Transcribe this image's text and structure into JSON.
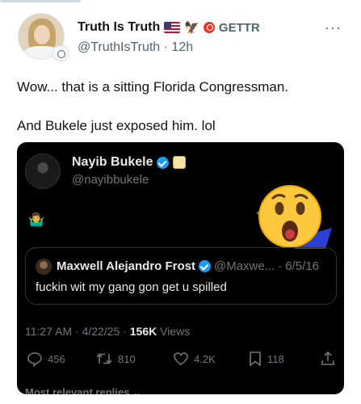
{
  "post": {
    "display_name": "Truth Is Truth",
    "badge_label": "GETTR",
    "handle": "@TruthIsTruth",
    "separator": "·",
    "time": "12h",
    "more_label": "···",
    "text_lines": [
      "Wow... that is a sitting Florida Congressman.",
      "And Bukele just exposed him. lol"
    ]
  },
  "embed": {
    "author_name": "Nayib Bukele",
    "author_handle": "@nayibbukele",
    "body_emoji": "🤷‍♂️",
    "reaction_emoji": "😮",
    "quote": {
      "name": "Maxwell Alejandro Frost",
      "handle": "@Maxwe...",
      "separator": "·",
      "date": "6/5/16",
      "text": "fuckin wit my gang gon get u spilled"
    },
    "stats": {
      "time": "11:27 AM",
      "dot1": "·",
      "date": "4/22/25",
      "dot2": "·",
      "views_count": "156K",
      "views_label": "Views"
    },
    "actions": {
      "replies": "456",
      "reposts": "810",
      "likes": "4.2K",
      "bookmarks": "118"
    },
    "footer_label": "Most relevant replies ⌄"
  },
  "colors": {
    "accent": "#1d9bf0",
    "embed_background": "#000000",
    "gettr_red": "#e8372c"
  },
  "icons": [
    "avatar-badge-icon",
    "us-flag-icon",
    "eagle-icon",
    "gettr-logo-icon",
    "verified-icon",
    "affiliate-badge-icon",
    "reply-icon",
    "repost-icon",
    "like-icon",
    "bookmark-icon",
    "share-icon"
  ]
}
